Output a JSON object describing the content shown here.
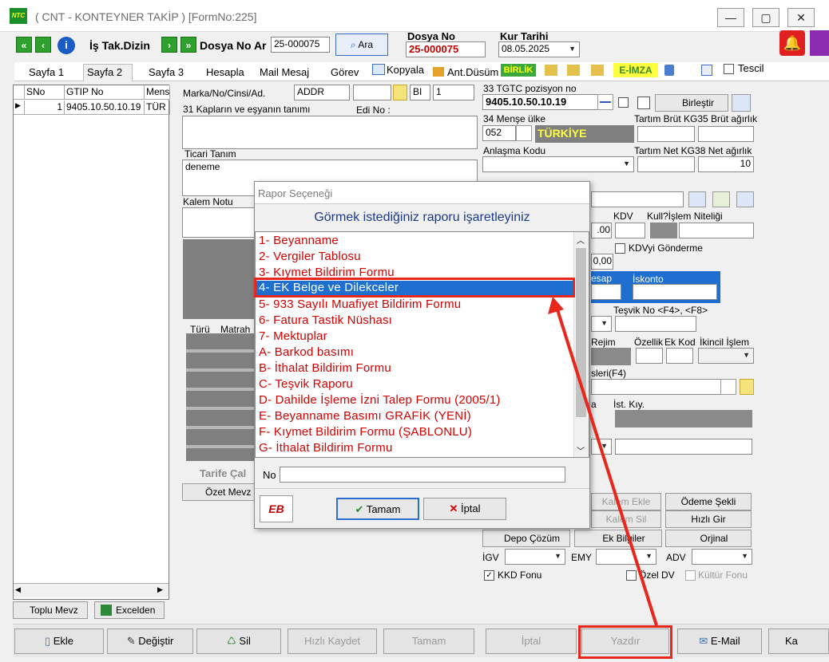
{
  "window": {
    "title": "( CNT - KONTEYNER TAKİP ) [FormNo:225]",
    "logo": "NTC"
  },
  "toolbar": {
    "is_tak_dizin": "İş Tak.Dizin",
    "dosya_no_label": "Dosya No Ar",
    "dosya_no_value": "25-000075",
    "ara": "Ara",
    "dosya_no_hdr": "Dosya No",
    "dosya_no_display": "25-000075",
    "kur_tarihi_hdr": "Kur Tarihi",
    "kur_tarihi_value": "08.05.2025"
  },
  "tabs": [
    "Sayfa 1",
    "Sayfa 2",
    "Sayfa 3",
    "Hesapla",
    "Mail Mesaj",
    "Görev",
    "Kopyala",
    "Ant.Düsüm",
    "BİRLİK",
    "E-İMZA",
    "Tescil"
  ],
  "grid": {
    "columns": [
      "SNo",
      "GTIP No",
      "Mens"
    ],
    "rows": [
      [
        "1",
        "9405.10.50.10.19",
        "TÜR"
      ]
    ]
  },
  "form": {
    "marka_label": "Marka/No/Cinsi/Ad.",
    "marka_value": "ADDR",
    "bi_value": "BI",
    "bi_num": "1",
    "kaplar_label": "31 Kapların ve eşyanın tanımı",
    "edi_label": "Edi No :",
    "ticari_label": "Ticari Tanım",
    "ticari_value": "deneme",
    "kalem_notu_label": "Kalem Notu",
    "gtip_label": "33 TGTC pozisyon no",
    "gtip_value": "9405.10.50.10.19",
    "birlestir": "Birleştir",
    "mense_label": "34 Menşe ülke",
    "mense_code": "052",
    "mense_name": "TÜRKİYE",
    "tartim_brut_label": "Tartım Brüt KG35 Brüt ağırlık",
    "anlasma_label": "Anlaşma Kodu",
    "tartim_net_label": "Tartım Net KG38 Net ağırlık",
    "net_value": "10",
    "kdv_label": "KDV",
    "kull_label": "Kull?İşlem Niteliği",
    "val_00a": ".00",
    "kdv_gonderme": "KDVyi Gönderme",
    "val_00b": "0,00",
    "hesap_label": "esap",
    "iskonto_label": "İskonto",
    "tesvik_label": "Teşvik No <F4>, <F8>",
    "rejim_label": "Rejim",
    "ozellik_label": "Özellik",
    "ek_kod_label": "Ek Kod",
    "ikincil_label": "İkincil İşlem",
    "sleri_label": "sleri(F4)",
    "a_label": "a",
    "ist_kiy_label": "İst. Kıy.",
    "turu_label": "Türü",
    "matrah_label": "Matrah",
    "tarife_label": "Tarife Çal",
    "ozet_label": "Özet Mevz",
    "kalem_ekle": "Kalem Ekle",
    "odeme_sekli": "Ödeme Şekli",
    "kalem_sil": "Kalem Sil",
    "hizli_gir": "Hızlı Gir",
    "depo_cozum": "Depo Çözüm",
    "ek_bilgiler": "Ek Bilgiler",
    "orjinal": "Orjinal",
    "igv_label": "İGV",
    "emy_label": "EMY",
    "adv_label": "ADV",
    "kkd_fonu": "KKD Fonu",
    "ozel_dv": "Özel DV",
    "kultur_fonu": "Kültür Fonu",
    "toplu_mevz": "Toplu Mevz",
    "excelden": "Excelden"
  },
  "dialog": {
    "title": "Rapor Seçeneği",
    "heading": "Görmek istediğiniz raporu işaretleyiniz",
    "items": [
      "1- Beyanname",
      "2- Vergiler Tablosu",
      "3- Kıymet Bildirim Formu",
      "4- EK Belge ve Dilekceler",
      "5- 933 Sayılı Muafiyet Bildirim Formu",
      "6- Fatura Tastik Nüshası",
      "7- Mektuplar",
      "A- Barkod basımı",
      "B- İthalat Bildirim Formu",
      "C- Teşvik Raporu",
      "D- Dahilde İşleme İzni Talep Formu (2005/1)",
      "E- Beyanname Basımı GRAFİK (YENİ)",
      "F- Kıymet Bildirim Formu (ŞABLONLU)",
      "G- İthalat Bildirim Formu"
    ],
    "selected_index": 3,
    "no_label": "No",
    "ok": "Tamam",
    "cancel": "İptal"
  },
  "bottom": [
    "Ekle",
    "Değiştir",
    "Sil",
    "Hızlı Kaydet",
    "Tamam",
    "İptal",
    "Yazdır",
    "E-Mail",
    "Ka"
  ],
  "colors": {
    "accent": "#1e6fd0",
    "list_text": "#d40000",
    "highlight": "#e8261c"
  }
}
